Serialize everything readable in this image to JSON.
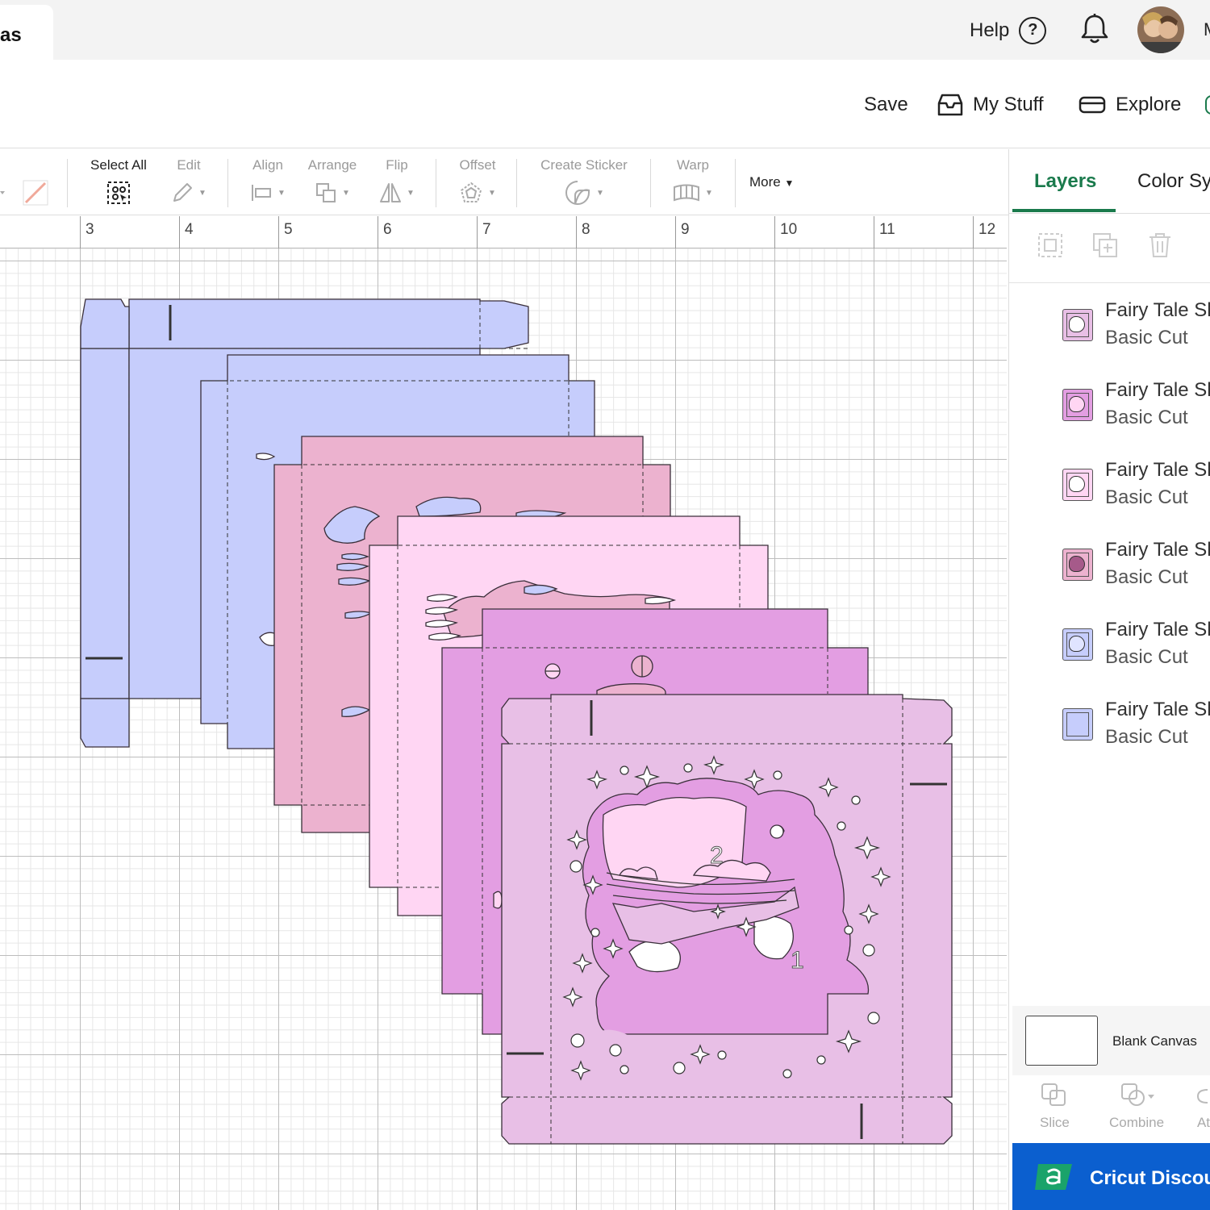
{
  "tab": {
    "title": "as"
  },
  "topbar": {
    "help_label": "Help",
    "help_glyph": "?",
    "user_initial": "M"
  },
  "header": {
    "save": "Save",
    "my_stuff": "My Stuff",
    "explore": "Explore"
  },
  "toolbar": {
    "select_all": "Select All",
    "edit": "Edit",
    "align": "Align",
    "arrange": "Arrange",
    "flip": "Flip",
    "offset": "Offset",
    "create_sticker": "Create Sticker",
    "warp": "Warp",
    "more": "More"
  },
  "ruler": {
    "ticks": [
      "3",
      "4",
      "5",
      "6",
      "7",
      "8",
      "9",
      "10",
      "11",
      "12"
    ]
  },
  "canvas": {
    "label_1": "1",
    "label_2": "2"
  },
  "panel": {
    "tabs": {
      "layers": "Layers",
      "color_sync": "Color Sy"
    },
    "layers": [
      {
        "name": "Fairy Tale Sh",
        "operation": "Basic Cut",
        "color": "#e8bfe6"
      },
      {
        "name": "Fairy Tale Sh",
        "operation": "Basic Cut",
        "color": "#e39ee2"
      },
      {
        "name": "Fairy Tale Sh",
        "operation": "Basic Cut",
        "color": "#ffd6f3"
      },
      {
        "name": "Fairy Tale Sh",
        "operation": "Basic Cut",
        "color": "#ecb2cf"
      },
      {
        "name": "Fairy Tale Sh",
        "operation": "Basic Cut",
        "color": "#c6cdfc"
      },
      {
        "name": "Fairy Tale Sh",
        "operation": "Basic Cut",
        "color": "#c6cdfc"
      }
    ],
    "blank_canvas": "Blank Canvas",
    "actions": {
      "slice": "Slice",
      "combine": "Combine",
      "attach": "At"
    },
    "discount": "Cricut Discou"
  },
  "colors": {
    "accent_green": "#1a7a4c",
    "discount_blue": "#0b5fcf"
  }
}
